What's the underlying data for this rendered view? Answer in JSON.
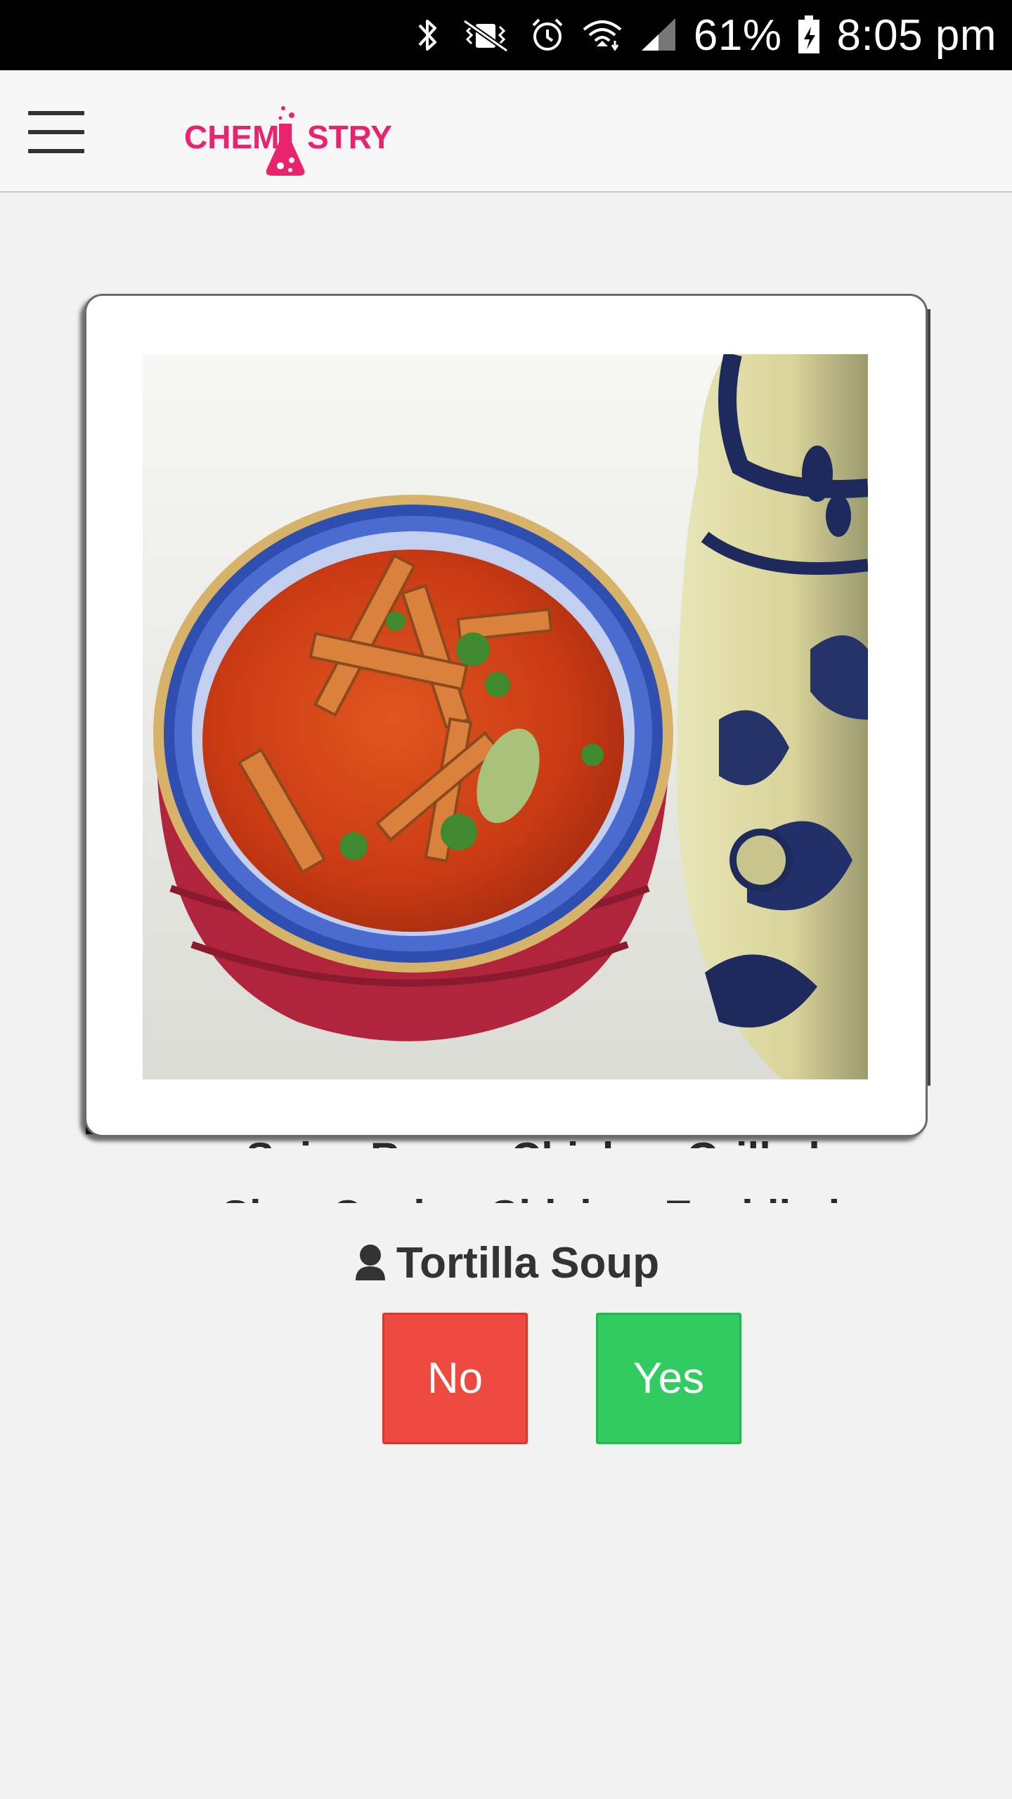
{
  "status_bar": {
    "battery": "61%",
    "time": "8:05 pm",
    "icons": [
      "bluetooth-icon",
      "vibrate-icon",
      "alarm-icon",
      "wifi-icon",
      "signal-icon",
      "battery-icon"
    ]
  },
  "app_bar": {
    "logo_text_left": "CHEM",
    "logo_text_right": "STRY",
    "brand_color": "#e8246e"
  },
  "back_cards": [
    {
      "text": "Spicy Bacon Chicken Grilled"
    },
    {
      "text": "Slow Cooker Chicken Enchiladas"
    }
  ],
  "card": {
    "recipe_name": "Tortilla Soup",
    "image_icon": "soup-photo"
  },
  "actions": {
    "no_label": "No",
    "yes_label": "Yes",
    "no_color": "#ef4a3f",
    "yes_color": "#31cb62"
  }
}
